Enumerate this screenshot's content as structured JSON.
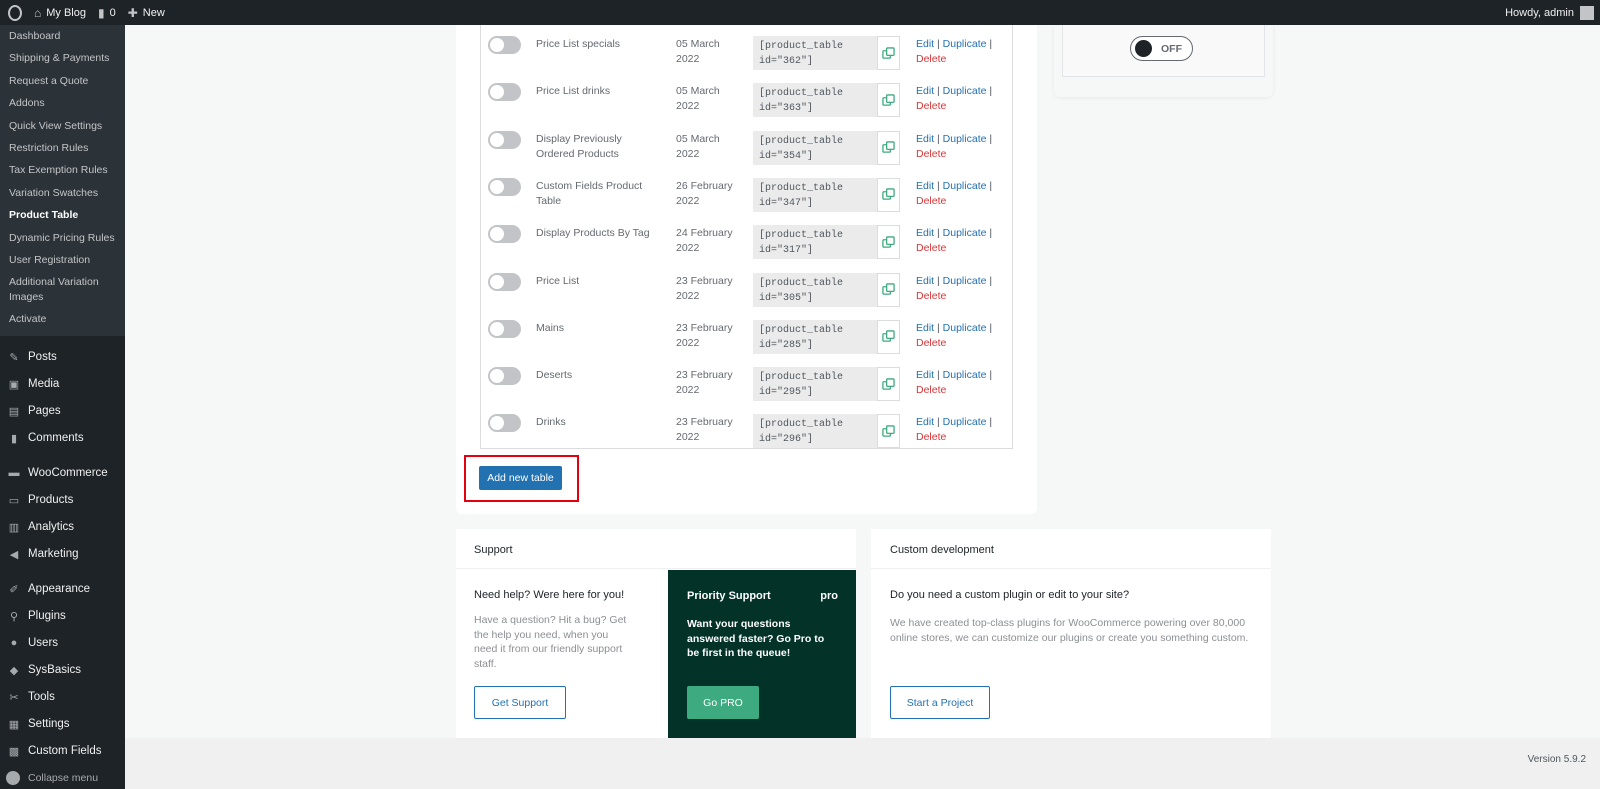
{
  "adminbar": {
    "site_name": "My Blog",
    "comments_count": "0",
    "new_label": "New",
    "greeting": "Howdy, admin"
  },
  "sidebar": {
    "submenu": [
      {
        "label": "Dashboard",
        "current": false
      },
      {
        "label": "Shipping & Payments",
        "current": false
      },
      {
        "label": "Request a Quote",
        "current": false
      },
      {
        "label": "Addons",
        "current": false
      },
      {
        "label": "Quick View Settings",
        "current": false
      },
      {
        "label": "Restriction Rules",
        "current": false
      },
      {
        "label": "Tax Exemption Rules",
        "current": false
      },
      {
        "label": "Variation Swatches",
        "current": false
      },
      {
        "label": "Product Table",
        "current": true
      },
      {
        "label": "Dynamic Pricing Rules",
        "current": false
      },
      {
        "label": "User Registration",
        "current": false
      },
      {
        "label": "Additional Variation Images",
        "current": false
      },
      {
        "label": "Activate",
        "current": false
      }
    ],
    "menu": [
      {
        "label": "Posts",
        "icon": "pin-icon",
        "sep_before": false
      },
      {
        "label": "Media",
        "icon": "media-icon",
        "sep_before": false
      },
      {
        "label": "Pages",
        "icon": "pages-icon",
        "sep_before": false
      },
      {
        "label": "Comments",
        "icon": "comment-icon",
        "sep_before": false
      },
      {
        "label": "WooCommerce",
        "icon": "woo-icon",
        "sep_before": true
      },
      {
        "label": "Products",
        "icon": "archive-icon",
        "sep_before": false
      },
      {
        "label": "Analytics",
        "icon": "chart-icon",
        "sep_before": false
      },
      {
        "label": "Marketing",
        "icon": "megaphone-icon",
        "sep_before": false
      },
      {
        "label": "Appearance",
        "icon": "brush-icon",
        "sep_before": true
      },
      {
        "label": "Plugins",
        "icon": "plug-icon",
        "sep_before": false
      },
      {
        "label": "Users",
        "icon": "user-icon",
        "sep_before": false
      },
      {
        "label": "SysBasics",
        "icon": "sysbasics-icon",
        "sep_before": false
      },
      {
        "label": "Tools",
        "icon": "wrench-icon",
        "sep_before": false
      },
      {
        "label": "Settings",
        "icon": "sliders-icon",
        "sep_before": false
      },
      {
        "label": "Custom Fields",
        "icon": "grid-icon",
        "sep_before": false
      }
    ],
    "collapse_label": "Collapse menu"
  },
  "tables": [
    {
      "name": "Price List specials",
      "date": "05 March 2022",
      "code": "[product_table\nid=\"362\"]"
    },
    {
      "name": "Price List drinks",
      "date": "05 March 2022",
      "code": "[product_table\nid=\"363\"]"
    },
    {
      "name": "Display Previously Ordered Products",
      "date": "05 March 2022",
      "code": "[product_table\nid=\"354\"]"
    },
    {
      "name": "Custom Fields Product Table",
      "date": "26 February 2022",
      "code": "[product_table\nid=\"347\"]"
    },
    {
      "name": "Display Products By Tag",
      "date": "24 February 2022",
      "code": "[product_table\nid=\"317\"]"
    },
    {
      "name": "Price List",
      "date": "23 February 2022",
      "code": "[product_table\nid=\"305\"]"
    },
    {
      "name": "Mains",
      "date": "23 February 2022",
      "code": "[product_table\nid=\"285\"]"
    },
    {
      "name": "Deserts",
      "date": "23 February 2022",
      "code": "[product_table\nid=\"295\"]"
    },
    {
      "name": "Drinks",
      "date": "23 February 2022",
      "code": "[product_table\nid=\"296\"]"
    }
  ],
  "row_actions": {
    "edit": "Edit",
    "duplicate": "Duplicate",
    "delete": "Delete",
    "sep": "|"
  },
  "add_new_label": "Add new table",
  "toggle_off_label": "OFF",
  "support": {
    "title": "Support",
    "heading": "Need help? Were here for you!",
    "text": "Have a question? Hit a bug? Get the help you need, when you need it from our friendly support staff.",
    "button": "Get Support",
    "priority_title": "Priority Support",
    "priority_badge": "pro",
    "priority_text": "Want your questions answered faster? Go Pro to be first in the queue!",
    "priority_button": "Go PRO"
  },
  "custom_dev": {
    "title": "Custom development",
    "heading": "Do you need a custom plugin or edit to your site?",
    "text": "We have created top-class plugins for WooCommerce powering over 80,000 online stores, we can customize our plugins or create you something custom.",
    "button": "Start a Project"
  },
  "footer": {
    "version": "Version 5.9.2"
  },
  "colors": {
    "accent": "#2271b1",
    "danger": "#d63638",
    "highlight": "#e3000f",
    "priority_bg": "#033229",
    "go_pro": "#3dab7f"
  }
}
